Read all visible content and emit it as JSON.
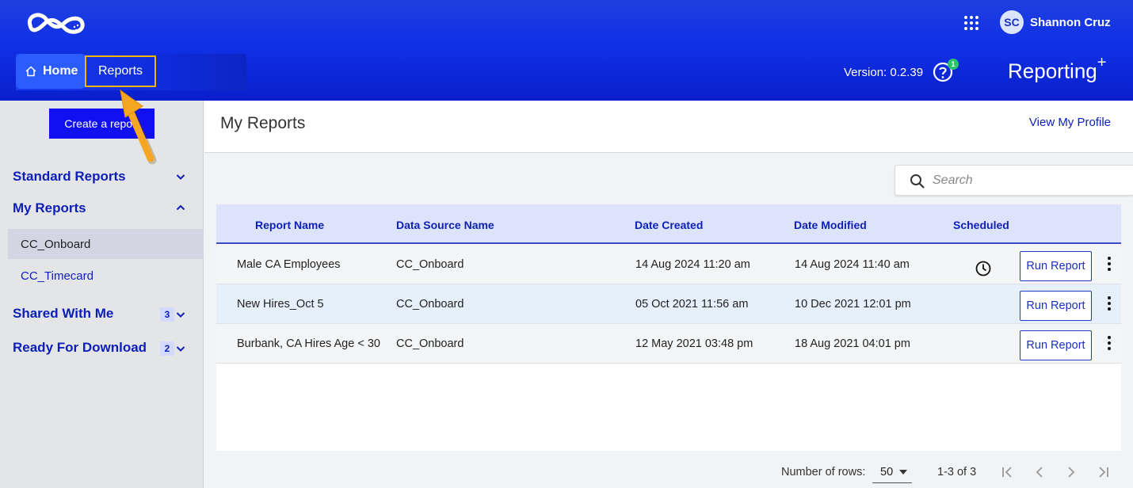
{
  "header": {
    "user_initials": "SC",
    "user_name": "Shannon Cruz",
    "nav": {
      "home_label": "Home",
      "reports_label": "Reports"
    },
    "version": "Version: 0.2.39",
    "help_badge": "1",
    "brand": "Reporting",
    "brand_sup": "+"
  },
  "sidebar": {
    "create_label": "Create a report",
    "sections": {
      "standard": "Standard Reports",
      "my": "My Reports",
      "shared": "Shared With Me",
      "shared_count": "3",
      "download": "Ready For Download",
      "download_count": "2"
    },
    "my_items": [
      "CC_Onboard",
      "CC_Timecard"
    ]
  },
  "main": {
    "title": "My Reports",
    "profile_link": "View My Profile",
    "search_placeholder": "Search"
  },
  "table": {
    "headers": {
      "name": "Report Name",
      "source": "Data Source Name",
      "created": "Date Created",
      "modified": "Date Modified",
      "scheduled": "Scheduled"
    },
    "run_label": "Run Report",
    "rows": [
      {
        "name": "Male CA Employees",
        "source": "CC_Onboard",
        "created": "14 Aug 2024 11:20 am",
        "modified": "14 Aug 2024 11:40 am",
        "scheduled": true
      },
      {
        "name": "New Hires_Oct 5",
        "source": "CC_Onboard",
        "created": "05 Oct 2021 11:56 am",
        "modified": "10 Dec 2021 12:01 pm",
        "scheduled": false
      },
      {
        "name": "Burbank, CA Hires Age < 30",
        "source": "CC_Onboard",
        "created": "12 May 2021 03:48 pm",
        "modified": "18 Aug 2021 04:01 pm",
        "scheduled": false
      }
    ]
  },
  "pagination": {
    "rows_label": "Number of rows:",
    "rows_value": "50",
    "range": "1-3 of 3"
  },
  "colors": {
    "header_blue": "#1030e6",
    "link_blue": "#0d1fb8",
    "highlight": "#f5b400"
  }
}
